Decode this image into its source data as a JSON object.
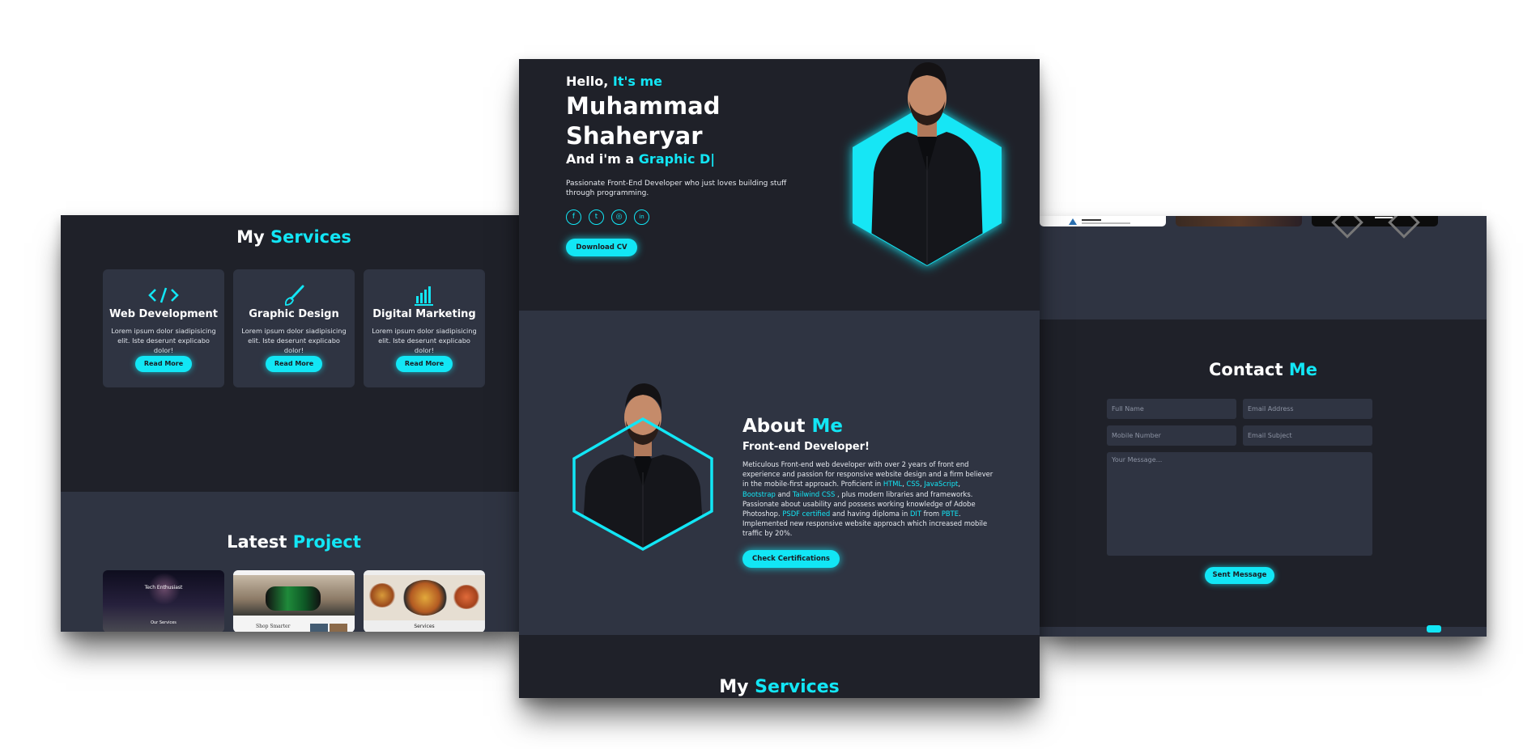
{
  "left": {
    "services_title": {
      "prefix": "My",
      "highlight": "Services"
    },
    "cards": [
      {
        "icon": "code-icon",
        "title": "Web Development",
        "desc": "Lorem ipsum dolor siadipisicing elit. Iste deserunt explicabo dolor!",
        "button": "Read More"
      },
      {
        "icon": "paintbrush-icon",
        "title": "Graphic Design",
        "desc": "Lorem ipsum dolor siadipisicing elit. Iste deserunt explicabo dolor!",
        "button": "Read More"
      },
      {
        "icon": "bar-chart-icon",
        "title": "Digital Marketing",
        "desc": "Lorem ipsum dolor siadipisicing elit. Iste deserunt explicabo dolor!",
        "button": "Read More"
      }
    ],
    "project_title": {
      "prefix": "Latest",
      "highlight": "Project"
    },
    "thumbs": [
      "Tech Enthusiast",
      "Our Services",
      "Shop Smarter",
      "Services"
    ]
  },
  "hero": {
    "greeting": "Hello,",
    "greeting_highlight": "It's me",
    "name_line1": "Muhammad",
    "name_line2": "Shaheryar",
    "role_prefix": "And i'm a",
    "role_highlight": "Graphic D|",
    "tagline": "Passionate Front-End Developer who just loves building stuff through programming.",
    "socials": [
      "facebook-icon",
      "twitter-icon",
      "instagram-icon",
      "linkedin-icon"
    ],
    "social_glyphs": [
      "f",
      "t",
      "◎",
      "in"
    ],
    "download": "Download CV"
  },
  "about": {
    "title": "About",
    "title_highlight": "Me",
    "subtitle": "Front-end Developer!",
    "p": {
      "t1": "Meticulous Front-end web developer with over 2 years of front end experience and passion for responsive website design and a firm believer in the mobile-first approach. Proficient in ",
      "html": "HTML",
      "c1": ", ",
      "css": "CSS",
      "c2": ", ",
      "js": "JavaScript",
      "c3": ", ",
      "bs": "Bootstrap",
      "and1": " and ",
      "tw": "Tailwind CSS",
      "t2": " , plus modern libraries and frameworks. Passionate about usability and possess working knowledge of Adobe Photoshop. ",
      "psdf": "PSDF certified",
      "t3": " and having diploma in ",
      "dit": "DIT",
      "from": " from ",
      "pbte": "PBTE",
      "t4": ". Implemented new responsive website approach which increased mobile traffic by 20%."
    },
    "button": "Check Certifications"
  },
  "services_bottom": {
    "prefix": "My",
    "highlight": "Services"
  },
  "contact": {
    "title": "Contact",
    "title_highlight": "Me",
    "full_name": "Full Name",
    "email": "Email Address",
    "mobile": "Mobile Number",
    "subject": "Email Subject",
    "message": "Your Message...",
    "send": "Sent Message"
  },
  "colors": {
    "accent": "#12e6f5",
    "dark": "#1f2129",
    "mid": "#2f3442"
  }
}
